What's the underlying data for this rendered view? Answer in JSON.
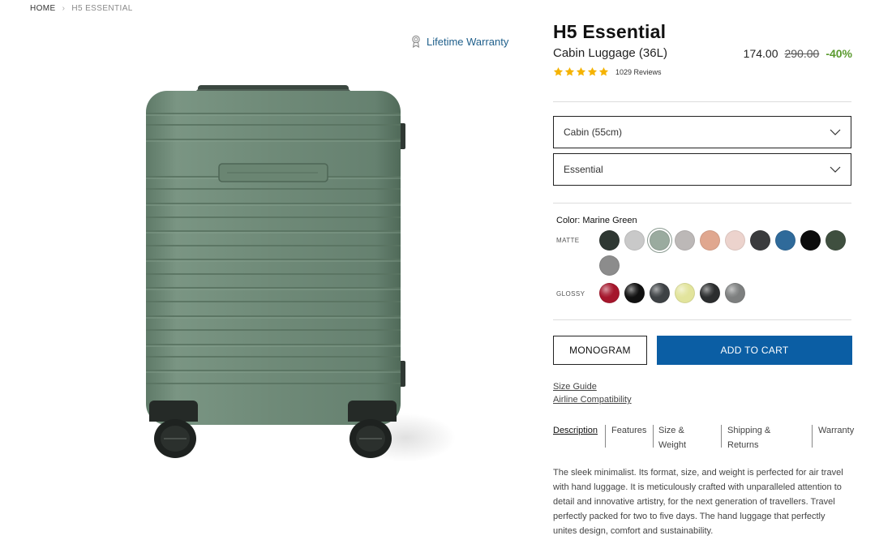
{
  "breadcrumb": {
    "home": "HOME",
    "separator": "›",
    "current": "H5 ESSENTIAL"
  },
  "warranty": {
    "label": "Lifetime Warranty",
    "icon": "award-ribbon-icon"
  },
  "product": {
    "name": "H5 Essential",
    "subtitle": "Cabin Luggage (36L)",
    "price": "174.00",
    "old_price": "290.00",
    "discount": "-40%",
    "rating_stars": 5,
    "reviews": "1029 Reviews",
    "suitcase_color": "#6f8a78"
  },
  "options": {
    "size": {
      "value": "Cabin (55cm)"
    },
    "edition": {
      "value": "Essential"
    }
  },
  "color": {
    "label": "Color: Marine Green",
    "matte_label": "MATTE",
    "glossy_label": "GLOSSY",
    "selected": "Marine Green",
    "matte": [
      "#2f3833",
      "#c9c9c9",
      "#9aab9f",
      "#bcb8b7",
      "#e0a78f",
      "#ecd3cd",
      "#3a3b3d",
      "#2f6a9a",
      "#0c0c0c",
      "#3f4f3f",
      "#8c8c8c"
    ],
    "glossy": [
      "#a5162c",
      "#111111",
      "#3e4245",
      "#e2e49c",
      "#2b2d2e",
      "#7d7f7f"
    ]
  },
  "actions": {
    "monogram": "MONOGRAM",
    "add_to_cart": "ADD TO CART"
  },
  "links": {
    "size_guide": "Size Guide",
    "airline": "Airline Compatibility"
  },
  "tabs": [
    {
      "line1": "Description",
      "line2": ""
    },
    {
      "line1": "Features",
      "line2": ""
    },
    {
      "line1": "Size &",
      "line2": "Weight"
    },
    {
      "line1": "Shipping &",
      "line2": "Returns"
    },
    {
      "line1": "Warranty",
      "line2": ""
    }
  ],
  "description": "The sleek minimalist. Its format, size, and weight is perfected for air travel with hand luggage. It is meticulously crafted with unparalleled attention to detail and innovative artistry, for the next generation of travellers. Travel perfectly packed for two to five days. The hand luggage that perfectly unites design, comfort and sustainability."
}
